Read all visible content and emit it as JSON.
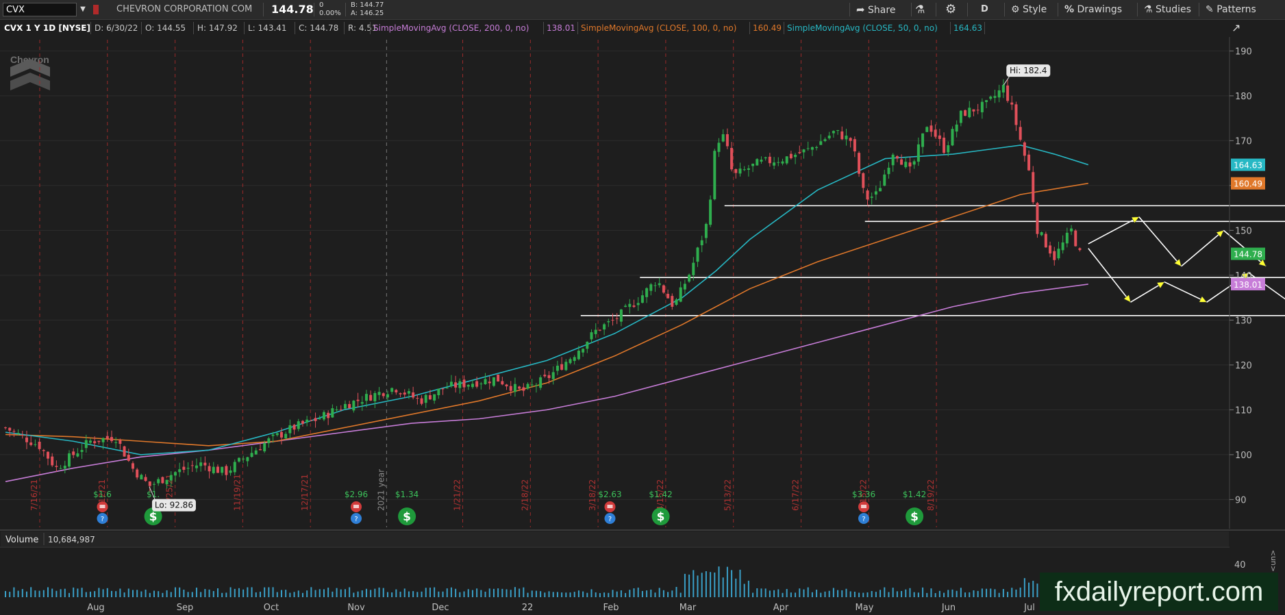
{
  "toolbar": {
    "symbol_input": "CVX",
    "company_name": "CHEVRON CORPORATION COM",
    "last_price": "144.78",
    "change": "0",
    "change_pct": "0.00%",
    "bid": "B: 144.77",
    "ask": "A: 146.25",
    "share_label": "Share",
    "interval_label": "D",
    "style_label": "Style",
    "drawings_label": "Drawings",
    "studies_label": "Studies",
    "patterns_label": "Patterns"
  },
  "studybar": {
    "chart_label": "CVX 1 Y 1D [NYSE]",
    "date": "D: 6/30/22",
    "open": "O: 144.55",
    "high": "H: 147.92",
    "low": "L: 143.41",
    "close": "C: 144.78",
    "range": "R: 4.51",
    "sma200_label": "SimpleMovingAvg (CLOSE, 200, 0, no)",
    "sma200_value": "138.01",
    "sma100_label": "SimpleMovingAvg (CLOSE, 100, 0, no)",
    "sma100_value": "160.49",
    "sma50_label": "SimpleMovingAvg (CLOSE, 50, 0, no)",
    "sma50_value": "164.63"
  },
  "volume": {
    "label": "Volume",
    "value": "10,684,987",
    "axis_tick": "40",
    "axis_side_label": "<un>"
  },
  "watermark": "fxdailyreport.com",
  "logo_text": "Chevron",
  "colors": {
    "sma200": "#c77dd8",
    "sma100": "#e0782a",
    "sma50": "#27b8c4",
    "up": "#2fae4e",
    "down": "#e0505a",
    "support_lines": "#ffffff",
    "arrow_heads": "#ffff33"
  },
  "chart_data": {
    "type": "candlestick",
    "title": "",
    "symbol": "CVX",
    "ylim": [
      85,
      192
    ],
    "y_ticks": [
      90,
      100,
      110,
      120,
      130,
      140,
      150,
      160,
      170,
      180,
      190
    ],
    "x_month_labels": [
      "Aug",
      "Sep",
      "Oct",
      "Nov",
      "Dec",
      "22",
      "Feb",
      "Mar",
      "Apr",
      "May",
      "Jun",
      "Jul"
    ],
    "vertical_date_labels": [
      "7/16/21",
      "9/12/21",
      "10/25/21",
      "11/19/21",
      "12/17/21",
      "2021 year",
      "1/21/22",
      "2/18/22",
      "3/18/22",
      "4/15/22",
      "5/13/22",
      "6/17/22",
      "7/15/22",
      "8/19/22"
    ],
    "x_weeks": [
      0,
      4,
      8,
      12,
      16,
      20,
      24,
      28,
      32,
      36,
      40,
      44,
      48,
      52,
      56
    ],
    "close_points": [
      [
        0,
        106
      ],
      [
        2,
        102
      ],
      [
        3,
        97
      ],
      [
        5,
        103
      ],
      [
        6.5,
        104
      ],
      [
        7.5,
        97
      ],
      [
        8.5,
        93
      ],
      [
        10,
        96
      ],
      [
        11.5,
        98
      ],
      [
        13,
        96
      ],
      [
        14,
        99
      ],
      [
        15.5,
        103
      ],
      [
        17,
        106
      ],
      [
        18.5,
        108
      ],
      [
        20,
        111
      ],
      [
        21.5,
        113
      ],
      [
        23,
        115
      ],
      [
        24.5,
        112
      ],
      [
        26,
        115
      ],
      [
        27.5,
        116
      ],
      [
        29,
        117
      ],
      [
        30.5,
        114
      ],
      [
        32,
        117
      ],
      [
        33.5,
        122
      ],
      [
        35,
        128
      ],
      [
        36,
        130
      ],
      [
        37.5,
        135
      ],
      [
        38.5,
        139
      ],
      [
        39.5,
        133
      ],
      [
        40.5,
        141
      ],
      [
        41.5,
        152
      ],
      [
        42,
        170
      ],
      [
        42.5,
        171
      ],
      [
        43,
        162
      ],
      [
        44.5,
        165
      ],
      [
        46,
        166
      ],
      [
        47.5,
        168
      ],
      [
        49,
        172
      ],
      [
        50,
        170
      ],
      [
        50.8,
        157
      ],
      [
        51.5,
        158
      ],
      [
        52.5,
        168
      ],
      [
        53.5,
        163
      ],
      [
        54.5,
        174
      ],
      [
        55.5,
        168
      ],
      [
        56.5,
        176
      ],
      [
        58,
        178
      ],
      [
        59,
        182
      ],
      [
        59.5,
        177
      ],
      [
        60,
        170
      ],
      [
        60.5,
        163
      ],
      [
        61,
        150
      ],
      [
        61.5,
        147
      ],
      [
        62,
        144
      ],
      [
        62.5,
        147
      ],
      [
        63,
        150
      ],
      [
        63.5,
        144.78
      ]
    ],
    "sma50": [
      [
        0,
        105
      ],
      [
        4,
        103
      ],
      [
        8,
        100
      ],
      [
        12,
        101
      ],
      [
        16,
        105
      ],
      [
        20,
        110
      ],
      [
        24,
        113
      ],
      [
        28,
        117
      ],
      [
        32,
        121
      ],
      [
        36,
        127
      ],
      [
        40,
        135
      ],
      [
        42,
        141
      ],
      [
        44,
        148
      ],
      [
        48,
        159
      ],
      [
        52,
        166
      ],
      [
        56,
        167
      ],
      [
        58,
        168
      ],
      [
        60,
        169
      ],
      [
        62,
        167
      ],
      [
        64,
        164.63
      ]
    ],
    "sma100": [
      [
        0,
        104.5
      ],
      [
        4,
        104
      ],
      [
        8,
        103
      ],
      [
        12,
        102
      ],
      [
        16,
        103
      ],
      [
        20,
        106
      ],
      [
        24,
        109
      ],
      [
        28,
        112
      ],
      [
        32,
        116
      ],
      [
        36,
        122
      ],
      [
        40,
        129
      ],
      [
        44,
        137
      ],
      [
        48,
        143
      ],
      [
        52,
        148
      ],
      [
        56,
        153
      ],
      [
        60,
        158
      ],
      [
        64,
        160.49
      ]
    ],
    "sma200": [
      [
        0,
        94
      ],
      [
        4,
        97
      ],
      [
        8,
        99.5
      ],
      [
        12,
        101
      ],
      [
        16,
        103
      ],
      [
        20,
        105
      ],
      [
        24,
        107
      ],
      [
        28,
        108
      ],
      [
        32,
        110
      ],
      [
        36,
        113
      ],
      [
        40,
        117
      ],
      [
        44,
        121
      ],
      [
        48,
        125
      ],
      [
        52,
        129
      ],
      [
        56,
        133
      ],
      [
        60,
        136
      ],
      [
        64,
        138.01
      ]
    ],
    "horizontal_levels": [
      {
        "y": 155.5,
        "x_start": 42.5
      },
      {
        "y": 152,
        "x_start": 50.8
      },
      {
        "y": 139.5,
        "x_start": 37.5
      },
      {
        "y": 131,
        "x_start": 34
      }
    ],
    "projection_upper": [
      [
        64,
        147
      ],
      [
        67,
        153
      ],
      [
        69.5,
        142
      ],
      [
        72,
        150
      ],
      [
        74.5,
        142
      ]
    ],
    "projection_lower": [
      [
        64,
        146
      ],
      [
        66.5,
        134
      ],
      [
        68.5,
        138.5
      ],
      [
        71,
        134
      ],
      [
        73.5,
        140.5
      ],
      [
        77,
        131
      ],
      [
        79,
        138
      ]
    ],
    "annotations": [
      {
        "text": "Hi: 182.4",
        "x": 59,
        "y": 182.4
      },
      {
        "text": "Lo: 92.86",
        "x": 8.5,
        "y": 92.86
      }
    ],
    "price_tags": [
      {
        "text": "164.63",
        "y": 164.63,
        "color": "#27b8c4"
      },
      {
        "text": "160.49",
        "y": 160.49,
        "color": "#e0782a"
      },
      {
        "text": "144.78",
        "y": 144.78,
        "color": "#2fae4e"
      },
      {
        "text": "138.01",
        "y": 138.01,
        "color": "#c77dd8"
      }
    ],
    "events": [
      {
        "x": 5,
        "label": "$1.6",
        "icons": [
          "earnings",
          "dividend-info"
        ]
      },
      {
        "x": 8,
        "label": "$1.",
        "icons": [
          "split-dollar"
        ]
      },
      {
        "x": 20,
        "label": "$2.96",
        "icons": [
          "earnings",
          "dividend-info"
        ]
      },
      {
        "x": 23,
        "label": "$1.34",
        "icons": [
          "split-dollar"
        ]
      },
      {
        "x": 35,
        "label": "$2.63",
        "icons": [
          "earnings",
          "dividend-info"
        ]
      },
      {
        "x": 38,
        "label": "$1.42",
        "icons": [
          "split-dollar"
        ]
      },
      {
        "x": 50,
        "label": "$3.36",
        "icons": [
          "earnings",
          "dividend-info"
        ]
      },
      {
        "x": 53,
        "label": "$1.42",
        "icons": [
          "split-dollar"
        ]
      }
    ]
  }
}
